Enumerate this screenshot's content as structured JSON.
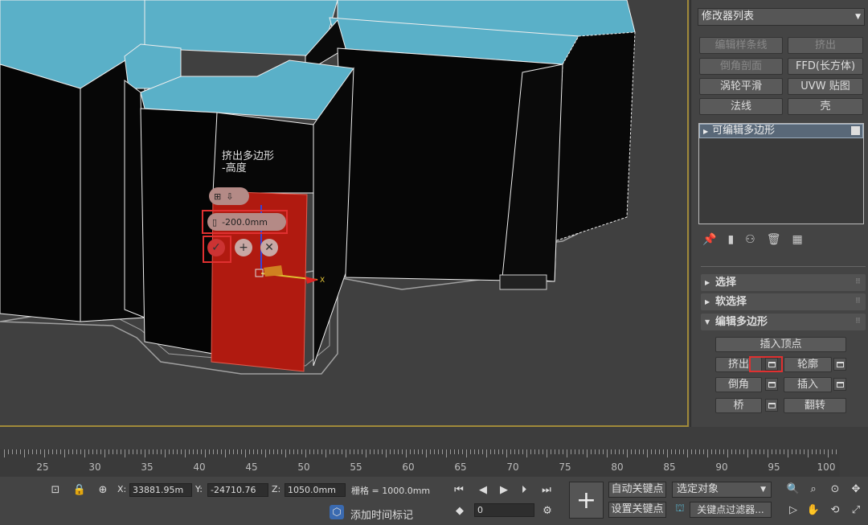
{
  "caddy": {
    "title_line1": "挤出多边形",
    "title_line2": "-高度",
    "height_value": "-200.0mm"
  },
  "axis_label": "X",
  "command_panel": {
    "modifier_list": "修改器列表",
    "buttons": [
      {
        "label": "编辑样条线",
        "enabled": false
      },
      {
        "label": "挤出",
        "enabled": false
      },
      {
        "label": "倒角剖面",
        "enabled": false
      },
      {
        "label": "FFD(长方体)",
        "enabled": true
      },
      {
        "label": "涡轮平滑",
        "enabled": true
      },
      {
        "label": "UVW 贴图",
        "enabled": true
      },
      {
        "label": "法线",
        "enabled": true
      },
      {
        "label": "壳",
        "enabled": true
      }
    ],
    "stack_item": "可编辑多边形",
    "rollouts": {
      "selection": "选择",
      "soft_selection": "软选择",
      "edit_polygons": "编辑多边形"
    },
    "edit_buttons": {
      "insert_vertex": "插入顶点",
      "extrude": "挤出",
      "outline": "轮廓",
      "bevel": "倒角",
      "inset": "插入",
      "bridge": "桥",
      "flip": "翻转"
    }
  },
  "timeline": {
    "ticks": [
      "25",
      "30",
      "35",
      "40",
      "45",
      "50",
      "55",
      "60",
      "65",
      "70",
      "75",
      "80",
      "85",
      "90",
      "95",
      "100"
    ]
  },
  "status": {
    "x_label": "X:",
    "x_value": "33881.95m",
    "y_label": "Y:",
    "y_value": "-24710.76",
    "z_label": "Z:",
    "z_value": "1050.0mm",
    "grid_text": "栅格 = 1000.0mm",
    "add_time_tag": "添加时间标记",
    "frame_value": "0",
    "auto_key": "自动关键点",
    "set_key": "设置关键点",
    "selected_object": "选定对象",
    "key_filters": "关键点过滤器..."
  },
  "colors": {
    "roof": "#5ab0c8",
    "wall": "#050505",
    "selected_face": "#b01a10",
    "viewport_border": "#a08a3a",
    "highlight_box": "#e03030"
  }
}
